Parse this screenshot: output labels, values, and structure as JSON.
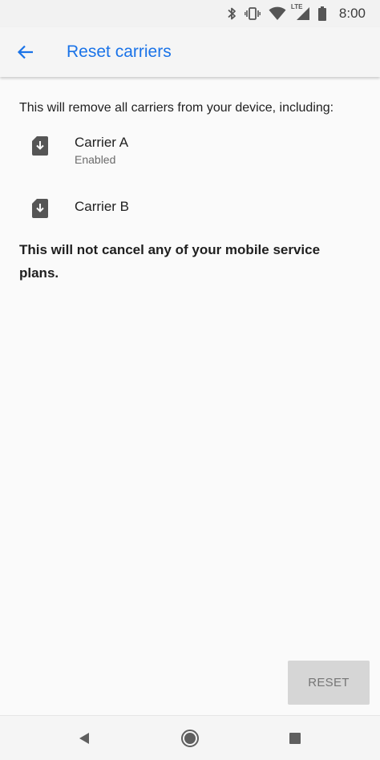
{
  "status_bar": {
    "time": "8:00",
    "icons": [
      "bluetooth-icon",
      "vibrate-icon",
      "wifi-icon",
      "lte-signal-icon",
      "battery-icon"
    ],
    "lte_label": "LTE"
  },
  "app_bar": {
    "title": "Reset carriers",
    "back_icon": "arrow-back-icon",
    "accent_color": "#1a73e8"
  },
  "content": {
    "intro": "This will remove all carriers from your device, including:",
    "carriers": [
      {
        "name": "Carrier A",
        "status": "Enabled",
        "icon": "sim-download-icon"
      },
      {
        "name": "Carrier B",
        "status": "",
        "icon": "sim-download-icon"
      }
    ],
    "notice": "This will not cancel any of your mobile service plans."
  },
  "actions": {
    "reset_label": "RESET",
    "reset_enabled": false
  },
  "nav_bar": {
    "icons": [
      "nav-back-icon",
      "nav-home-icon",
      "nav-recents-icon"
    ]
  }
}
